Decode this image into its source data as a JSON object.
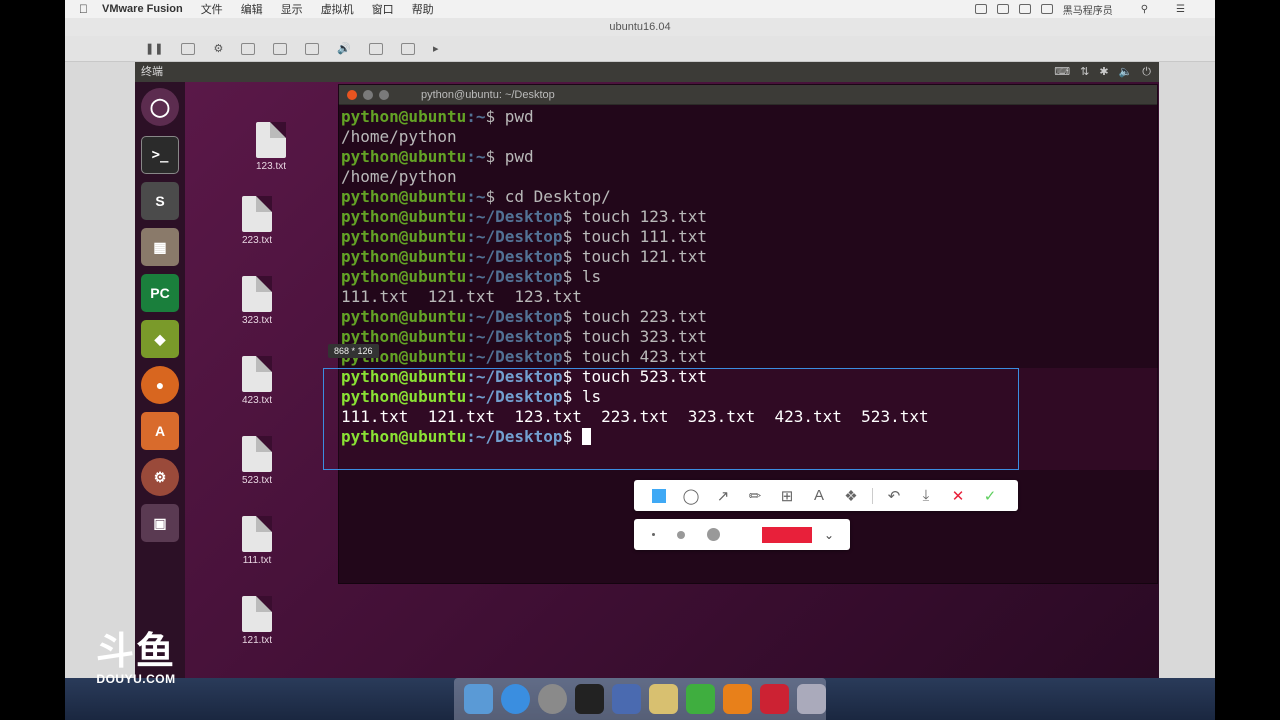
{
  "mac_menubar": {
    "app_name": "VMware Fusion",
    "menus": [
      "文件",
      "编辑",
      "显示",
      "虚拟机",
      "窗口",
      "帮助"
    ],
    "user": "黑马程序员"
  },
  "vm_window": {
    "title": "ubuntu16.04"
  },
  "ubuntu": {
    "top_bar_title": "终端",
    "desktop_files": [
      "123.txt",
      "223.txt",
      "323.txt",
      "423.txt",
      "523.txt",
      "111.txt",
      "121.txt"
    ]
  },
  "terminal": {
    "title": "python@ubuntu: ~/Desktop",
    "lines": [
      {
        "user": "python@ubuntu",
        "path": ":~",
        "cmd": "$ pwd"
      },
      {
        "out": "/home/python"
      },
      {
        "user": "python@ubuntu",
        "path": ":~",
        "cmd": "$ pwd"
      },
      {
        "out": "/home/python"
      },
      {
        "user": "python@ubuntu",
        "path": ":~",
        "cmd": "$ cd Desktop/"
      },
      {
        "user": "python@ubuntu",
        "path": ":~/Desktop",
        "cmd": "$ touch 123.txt"
      },
      {
        "user": "python@ubuntu",
        "path": ":~/Desktop",
        "cmd": "$ touch 111.txt"
      },
      {
        "user": "python@ubuntu",
        "path": ":~/Desktop",
        "cmd": "$ touch 121.txt"
      },
      {
        "user": "python@ubuntu",
        "path": ":~/Desktop",
        "cmd": "$ ls"
      },
      {
        "out": "111.txt  121.txt  123.txt"
      },
      {
        "user": "python@ubuntu",
        "path": ":~/Desktop",
        "cmd": "$ touch 223.txt"
      },
      {
        "user": "python@ubuntu",
        "path": ":~/Desktop",
        "cmd": "$ touch 323.txt"
      },
      {
        "user": "python@ubuntu",
        "path": ":~/Desktop",
        "cmd": "$ touch 423.txt"
      },
      {
        "user": "python@ubuntu",
        "path": ":~/Desktop",
        "cmd": "$ touch 523.txt"
      },
      {
        "user": "python@ubuntu",
        "path": ":~/Desktop",
        "cmd": "$ ls"
      },
      {
        "out": "111.txt  121.txt  123.txt  223.txt  323.txt  423.txt  523.txt"
      },
      {
        "user": "python@ubuntu",
        "path": ":~/Desktop",
        "cmd": "$ ",
        "cursor": true
      }
    ]
  },
  "screenshot_tool": {
    "size_label": "868 * 126",
    "color": "#e8203a",
    "tools": [
      "rectangle-icon",
      "ellipse-icon",
      "arrow-icon",
      "brush-icon",
      "mosaic-icon",
      "text-icon",
      "tag-icon",
      "undo-icon",
      "download-icon",
      "close-icon",
      "confirm-icon"
    ]
  },
  "watermark": {
    "cn": "斗鱼",
    "en": "DOUYU.COM"
  }
}
